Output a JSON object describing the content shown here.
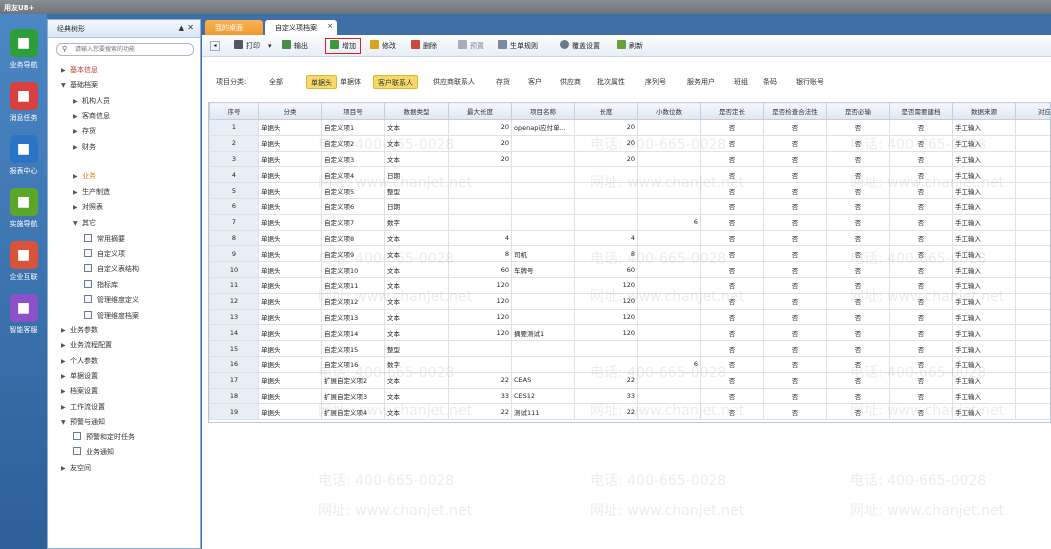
{
  "app_title": "用友U8+",
  "left_nav": [
    {
      "label": "业务导航",
      "icon": "business-nav-icon",
      "color": "#2e9e3a"
    },
    {
      "label": "消息任务",
      "icon": "message-task-icon",
      "color": "#d94040"
    },
    {
      "label": "报表中心",
      "icon": "report-center-icon",
      "color": "#2a74c6"
    },
    {
      "label": "实施导航",
      "icon": "implement-nav-icon",
      "color": "#5aa72a"
    },
    {
      "label": "企业互联",
      "icon": "enterprise-link-icon",
      "color": "#d9533a"
    },
    {
      "label": "智能客服",
      "icon": "smart-service-icon",
      "color": "#8a52c6"
    }
  ],
  "tree_panel": {
    "title": "经典树形",
    "pin_glyph": "▲",
    "close_glyph": "✕",
    "search_placeholder": "请输入您要搜索的功能",
    "nodes": [
      {
        "label": "基本信息",
        "arrow": "▶",
        "color": "red"
      },
      {
        "label": "基础档案",
        "arrow": "▼"
      },
      {
        "label": "机构人员",
        "arrow": "▶"
      },
      {
        "label": "客商信息",
        "arrow": "▶"
      },
      {
        "label": "存货",
        "arrow": "▶"
      },
      {
        "label": "财务",
        "arrow": "▶"
      },
      {
        "label": "业务",
        "arrow": "▶",
        "color": "orange"
      },
      {
        "label": "生产制造",
        "arrow": "▶"
      },
      {
        "label": "对照表",
        "arrow": "▶"
      },
      {
        "label": "其它",
        "arrow": "▼"
      },
      {
        "label": "常用摘要",
        "arrow": ""
      },
      {
        "label": "自定义项",
        "arrow": ""
      },
      {
        "label": "自定义表结构",
        "arrow": ""
      },
      {
        "label": "指标库",
        "arrow": ""
      },
      {
        "label": "管理维度定义",
        "arrow": ""
      },
      {
        "label": "管理维度档案",
        "arrow": ""
      },
      {
        "label": "业务参数",
        "arrow": "▶"
      },
      {
        "label": "业务流程配置",
        "arrow": "▶"
      },
      {
        "label": "个人参数",
        "arrow": "▶"
      },
      {
        "label": "单据设置",
        "arrow": "▶"
      },
      {
        "label": "档案设置",
        "arrow": "▶"
      },
      {
        "label": "工作流设置",
        "arrow": "▶"
      },
      {
        "label": "预警与通知",
        "arrow": "▼"
      },
      {
        "label": "预警和定时任务",
        "arrow": ""
      },
      {
        "label": "业务通知",
        "arrow": ""
      },
      {
        "label": "友空间",
        "arrow": "▶"
      }
    ]
  },
  "tabs": [
    {
      "label": "我的桌面"
    },
    {
      "label": "自定义项档案",
      "close": "×"
    }
  ],
  "toolbar": {
    "nav_glyph": "◂",
    "print": "打印",
    "export": "输出",
    "add": "增加",
    "edit": "修改",
    "delete": "删除",
    "preview": "预置",
    "generate": "生单规则",
    "page_setup": "覆盖设置",
    "refresh": "刷新",
    "dropdown_glyph": "▾"
  },
  "category_bar": {
    "label": "项目分类:",
    "items": [
      "全部",
      "单据头",
      "单据体",
      "客户联系人",
      "供应商联系人",
      "存货",
      "客户",
      "供应商",
      "批次属性",
      "序列号",
      "服务用户",
      "班组",
      "条码",
      "银行账号"
    ],
    "selected": 1,
    "highlighted": 3
  },
  "grid": {
    "columns": [
      "序号",
      "分类",
      "项目号",
      "数据类型",
      "最大长度",
      "项目名称",
      "长度",
      "小数位数",
      "是否定长",
      "是否检查合法性",
      "是否必输",
      "是否需要建档",
      "数据来源",
      "对应"
    ],
    "rows": [
      [
        "1",
        "单据头",
        "自定义项1",
        "文本",
        "20",
        "openapi应付单...",
        "20",
        "",
        "否",
        "否",
        "否",
        "否",
        "手工输入"
      ],
      [
        "2",
        "单据头",
        "自定义项2",
        "文本",
        "20",
        "",
        "20",
        "",
        "否",
        "否",
        "否",
        "否",
        "手工输入"
      ],
      [
        "3",
        "单据头",
        "自定义项3",
        "文本",
        "20",
        "",
        "20",
        "",
        "否",
        "否",
        "否",
        "否",
        "手工输入"
      ],
      [
        "4",
        "单据头",
        "自定义项4",
        "日期",
        "",
        "",
        "",
        "",
        "否",
        "否",
        "否",
        "否",
        "手工输入"
      ],
      [
        "5",
        "单据头",
        "自定义项5",
        "整型",
        "",
        "",
        "",
        "",
        "否",
        "否",
        "否",
        "否",
        "手工输入"
      ],
      [
        "6",
        "单据头",
        "自定义项6",
        "日期",
        "",
        "",
        "",
        "",
        "否",
        "否",
        "否",
        "否",
        "手工输入"
      ],
      [
        "7",
        "单据头",
        "自定义项7",
        "数字",
        "",
        "",
        "",
        "6",
        "否",
        "否",
        "否",
        "否",
        "手工输入"
      ],
      [
        "8",
        "单据头",
        "自定义项8",
        "文本",
        "4",
        "",
        "4",
        "",
        "否",
        "否",
        "否",
        "否",
        "手工输入"
      ],
      [
        "9",
        "单据头",
        "自定义项9",
        "文本",
        "8",
        "司机",
        "8",
        "",
        "否",
        "否",
        "否",
        "否",
        "手工输入"
      ],
      [
        "10",
        "单据头",
        "自定义项10",
        "文本",
        "60",
        "车牌号",
        "60",
        "",
        "否",
        "否",
        "否",
        "否",
        "手工输入"
      ],
      [
        "11",
        "单据头",
        "自定义项11",
        "文本",
        "120",
        "",
        "120",
        "",
        "否",
        "否",
        "否",
        "否",
        "手工输入"
      ],
      [
        "12",
        "单据头",
        "自定义项12",
        "文本",
        "120",
        "",
        "120",
        "",
        "否",
        "否",
        "否",
        "否",
        "手工输入"
      ],
      [
        "13",
        "单据头",
        "自定义项13",
        "文本",
        "120",
        "",
        "120",
        "",
        "否",
        "否",
        "否",
        "否",
        "手工输入"
      ],
      [
        "14",
        "单据头",
        "自定义项14",
        "文本",
        "120",
        "摘要测试1",
        "120",
        "",
        "否",
        "否",
        "否",
        "否",
        "手工输入"
      ],
      [
        "15",
        "单据头",
        "自定义项15",
        "整型",
        "",
        "",
        "",
        "",
        "否",
        "否",
        "否",
        "否",
        "手工输入"
      ],
      [
        "16",
        "单据头",
        "自定义项16",
        "数字",
        "",
        "",
        "",
        "6",
        "否",
        "否",
        "否",
        "否",
        "手工输入"
      ],
      [
        "17",
        "单据头",
        "扩展自定义项2",
        "文本",
        "22",
        "CEAS",
        "22",
        "",
        "否",
        "否",
        "否",
        "否",
        "手工输入"
      ],
      [
        "18",
        "单据头",
        "扩展自定义项3",
        "文本",
        "33",
        "CES12",
        "33",
        "",
        "否",
        "否",
        "否",
        "否",
        "手工输入"
      ],
      [
        "19",
        "单据头",
        "扩展自定义项4",
        "文本",
        "22",
        "测试111",
        "22",
        "",
        "否",
        "否",
        "否",
        "否",
        "手工输入"
      ]
    ]
  },
  "watermark": {
    "phone": "电话: 400-665-0028",
    "site": "网址: www.chanjet.net"
  }
}
